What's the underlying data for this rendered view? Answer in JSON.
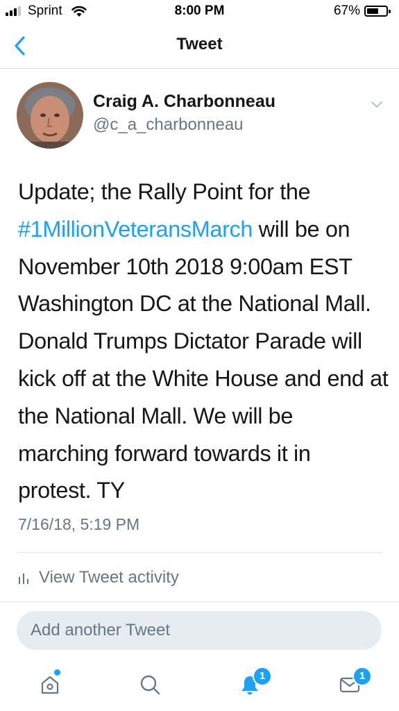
{
  "status_bar": {
    "carrier": "Sprint",
    "time": "8:00 PM",
    "battery_percent": "67%",
    "battery_level": 0.67,
    "signal_bars_filled": 3,
    "signal_bars_total": 4
  },
  "header": {
    "title": "Tweet",
    "back_icon": "chevron-left-icon"
  },
  "tweet": {
    "author_name": "Craig A. Charbonneau",
    "author_handle": "@c_a_charbonneau",
    "text_before_hashtag": "Update; the Rally Point for the",
    "hashtag": "#1MillionVeteransMarch",
    "text_after_hashtag": " will be on November 10th 2018 9:00am EST Washington DC at the National Mall. Donald Trumps Dictator Parade will kick off at the White House and end at the National Mall. We will be marching forward towards it in protest. TY",
    "timestamp": "7/16/18, 5:19 PM"
  },
  "activity": {
    "label": "View Tweet activity",
    "icon": "bar-chart-icon"
  },
  "reply": {
    "placeholder": "Add another Tweet"
  },
  "tabbar": {
    "home_icon": "home-icon",
    "search_icon": "search-icon",
    "notifications_icon": "bell-icon",
    "notifications_badge": "1",
    "messages_icon": "mail-icon",
    "messages_badge": "1"
  },
  "colors": {
    "accent": "#1da1f2",
    "text_primary": "#14171a",
    "text_secondary": "#657786",
    "reply_bg": "#e6ecf0"
  }
}
